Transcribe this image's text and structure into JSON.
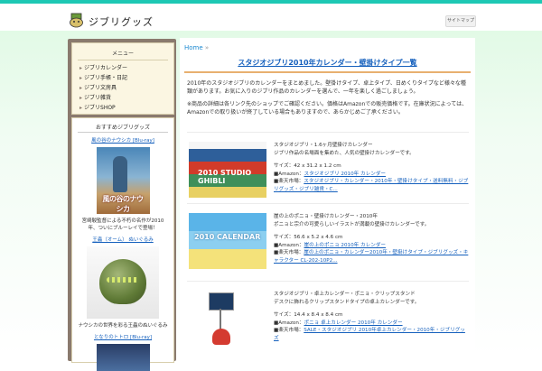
{
  "header": {
    "site_name": "ジブリグッズ",
    "top_button": "サイトマップ"
  },
  "sidebar": {
    "menu_title": "メニュー",
    "menu_items": [
      {
        "label": "ジブリカレンダー"
      },
      {
        "label": "ジブリ手帳・日記"
      },
      {
        "label": "ジブリ文房具"
      },
      {
        "label": "ジブリ雑貨"
      },
      {
        "label": "ジブリSHOP"
      }
    ],
    "featured_title": "おすすめジブリグッズ",
    "products": [
      {
        "link": "風の谷のナウシカ [Blu-ray]",
        "image_title": "風の谷のナウシカ",
        "desc": "宮崎駿監督による不朽の名作が2010年、ついにブルーレイで登場！"
      },
      {
        "link": "王蟲（オーム） ぬいぐるみ",
        "desc": "ナウシカの世界を彩る王蟲のぬいぐるみ"
      },
      {
        "link": "となりのトトロ [Blu-ray]"
      }
    ]
  },
  "main": {
    "breadcrumb_home": "Home",
    "breadcrumb_sep": "»",
    "title": "スタジオジブリ2010年カレンダー・壁掛けタイプ一覧",
    "intro": [
      "2010年のスタジオジブリのカレンダーをまとめました。壁掛けタイプ、卓上タイプ、日めくりタイプなど様々な種類があります。お気に入りのジブリ作品のカレンダーを選んで、一年を楽しく過ごしましょう。",
      "※商品の詳細は各リンク先のショップでご確認ください。価格はAmazonでの販売価格です。在庫状況によっては、Amazonでの取り扱いが終了している場合もありますので、あらかじめご了承ください。"
    ],
    "items": [
      {
        "line1": "スタジオジブリ・1.6ヶ月壁掛けカレンダー",
        "line2": "ジブリ作品の名場面を集めた、人気の壁掛けカレンダーです。",
        "size": "サイズ：42 x 31.2 x 1.2 cm",
        "amazon_prefix": "■Amazon：",
        "amazon_link": "スタジオジブリ 2010年 カレンダー",
        "shop_prefix": "■楽天市場：",
        "shop_link": "スタジオジブリ・カレンダー・2010年・壁掛けタイプ・送料無料・ジブリグッズ・ジブリ雑貨・C..."
      },
      {
        "line1": "崖の上のポニョ・壁掛けカレンダー・2010年",
        "line2": "ポニョと宗介の可愛らしいイラストが満載の壁掛けカレンダーです。",
        "size": "サイズ：56.6 x 5.2 x 4.6 cm",
        "amazon_prefix": "■Amazon：",
        "amazon_link": "崖の上のポニョ 2010年 カレンダー",
        "shop_prefix": "■楽天市場：",
        "shop_link": "崖の上のポニョ・カレンダー2010年・壁掛けタイプ・ジブリグッズ・キャラクター CL-202-10P2..."
      },
      {
        "line1": "スタジオジブリ・卓上カレンダー・ポニョ・クリップスタンド",
        "line2": "デスクに飾れるクリップスタンドタイプの卓上カレンダーです。",
        "size": "サイズ：14.4 x 8.4 x 8.4 cm",
        "amazon_prefix": "■Amazon：",
        "amazon_link": "ポニョ 卓上カレンダー 2010年 カレンダー",
        "shop_prefix": "■楽天市場：",
        "shop_link": "SALE・スタジオジブリ 2010年卓上カレンダー・2010年・ジブリグッズ"
      }
    ]
  }
}
